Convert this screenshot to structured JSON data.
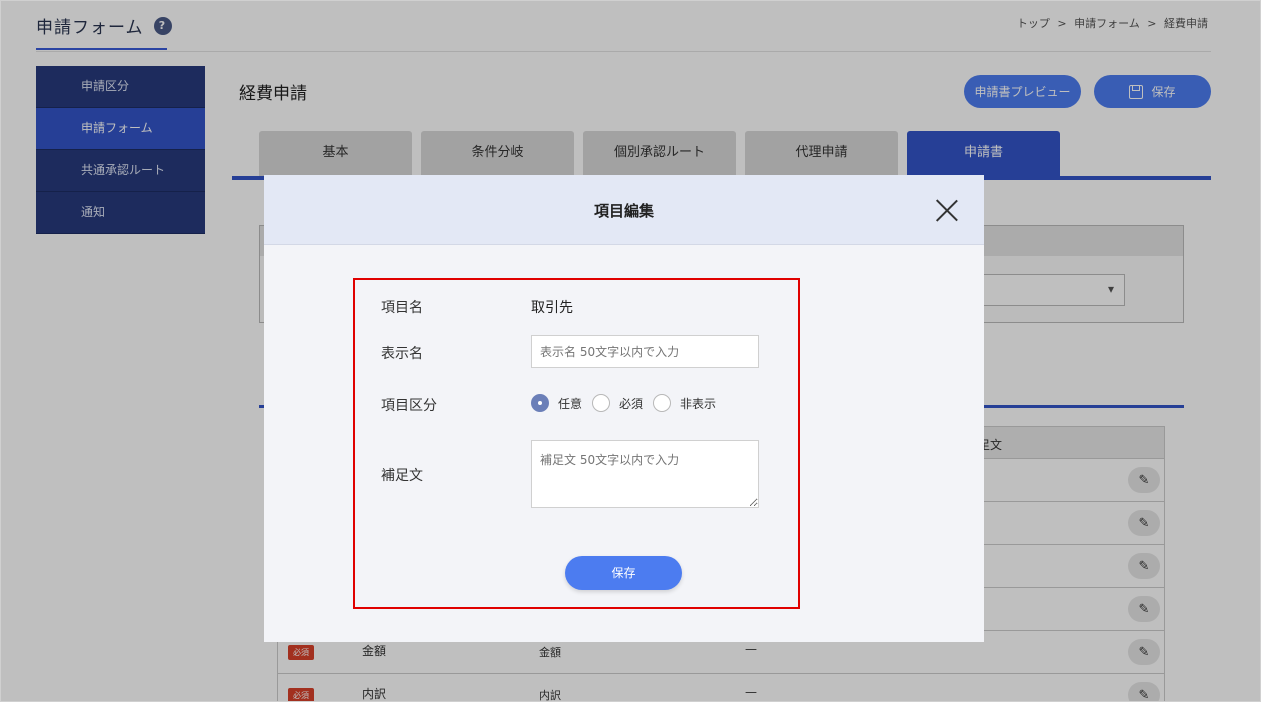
{
  "header": {
    "title": "申請フォーム",
    "help_icon_glyph": "?",
    "breadcrumb": [
      "トップ",
      "申請フォーム",
      "経費申請"
    ],
    "breadcrumb_sep": ">"
  },
  "sidebar": {
    "items": [
      {
        "label": "申請区分",
        "active": false
      },
      {
        "label": "申請フォーム",
        "active": true
      },
      {
        "label": "共通承認ルート",
        "active": false
      },
      {
        "label": "通知",
        "active": false
      }
    ]
  },
  "main": {
    "title": "経費申請",
    "preview_button": "申請書プレビュー",
    "save_button": "保存",
    "tabs": [
      {
        "label": "基本",
        "active": false
      },
      {
        "label": "条件分岐",
        "active": false
      },
      {
        "label": "個別承認ルート",
        "active": false
      },
      {
        "label": "代理申請",
        "active": false
      },
      {
        "label": "申請書",
        "active": true
      }
    ],
    "table": {
      "header_col4": "足文",
      "rows": [
        {
          "badge": "必須",
          "name": "金額",
          "type": "金額",
          "note": "—"
        },
        {
          "badge": "必須",
          "name": "内訳",
          "type": "内訳",
          "note": "—"
        }
      ]
    }
  },
  "modal": {
    "title": "項目編集",
    "fields": {
      "item_name_label": "項目名",
      "item_name_value": "取引先",
      "display_name_label": "表示名",
      "display_name_placeholder": "表示名 50文字以内で入力",
      "category_label": "項目区分",
      "category_options": [
        "任意",
        "必須",
        "非表示"
      ],
      "category_selected": "任意",
      "note_label": "補足文",
      "note_placeholder": "補足文 50文字以内で入力"
    },
    "save_button": "保存"
  },
  "colors": {
    "accent": "#3354c8",
    "button": "#4c7cf0",
    "sidebar": "#273a7c",
    "highlight": "#e00000",
    "badge": "#d8412a"
  }
}
